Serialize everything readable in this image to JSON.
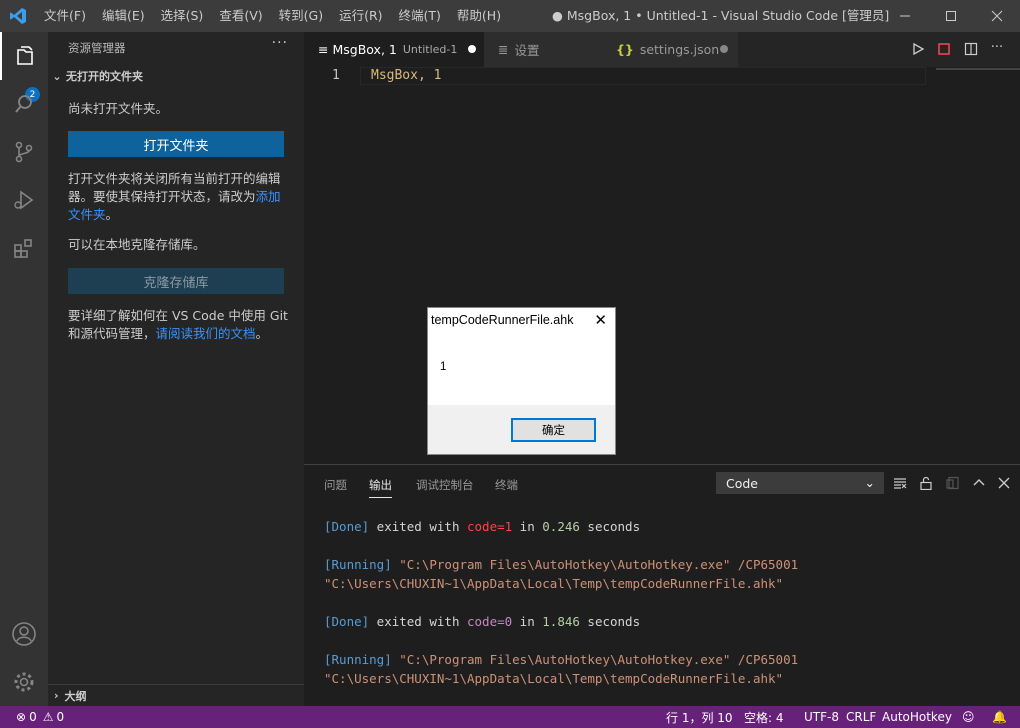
{
  "titlebar": {
    "menus": [
      "文件(F)",
      "编辑(E)",
      "选择(S)",
      "查看(V)",
      "转到(G)",
      "运行(R)",
      "终端(T)",
      "帮助(H)"
    ],
    "window_title": "● MsgBox, 1 • Untitled-1 - Visual Studio Code [管理员]"
  },
  "activitybar": {
    "badge": "2"
  },
  "sidebar": {
    "title": "资源管理器",
    "more": "···",
    "section": "无打开的文件夹",
    "no_folder": "尚未打开文件夹。",
    "open_button": "打开文件夹",
    "info_part1": "打开文件夹将关闭所有当前打开的编辑器。要使其保持打开状态，请改为",
    "info_link": "添加文件夹",
    "info_end": "。",
    "clone_info": "可以在本地克隆存储库。",
    "clone_button": "克隆存储库",
    "git_part1": "要详细了解如何在 VS Code 中使用 Git 和源代码管理，",
    "git_link": "请阅读我们的文档",
    "git_end": "。",
    "outline": "大纲"
  },
  "tabs": [
    {
      "label": "MsgBox, 1",
      "sub": "Untitled-1"
    },
    {
      "label": "设置"
    },
    {
      "label": "settings.json"
    }
  ],
  "editor": {
    "line_number": "1",
    "code": "MsgBox, 1"
  },
  "panel": {
    "tabs": [
      "问题",
      "输出",
      "调试控制台",
      "终端"
    ],
    "channel": "Code",
    "output": [
      {
        "tag": "[Done]",
        "t1": " exited with ",
        "code": "code=1",
        "t2": " in ",
        "secs": "0.246",
        "t3": " seconds"
      },
      {
        "tag": "[Running]",
        "cmd1": " \"C:\\Program Files\\AutoHotkey\\AutoHotkey.exe\" /CP65001",
        "cmd2": "\"C:\\Users\\CHUXIN~1\\AppData\\Local\\Temp\\tempCodeRunnerFile.ahk\""
      },
      {
        "tag": "[Done]",
        "t1": " exited with ",
        "code": "code=0",
        "t2": " in ",
        "secs": "1.846",
        "t3": " seconds"
      },
      {
        "tag": "[Running]",
        "cmd1": " \"C:\\Program Files\\AutoHotkey\\AutoHotkey.exe\" /CP65001",
        "cmd2": "\"C:\\Users\\CHUXIN~1\\AppData\\Local\\Temp\\tempCodeRunnerFile.ahk\""
      }
    ]
  },
  "dialog": {
    "title": "tempCodeRunnerFile.ahk",
    "close": "✕",
    "message": "1",
    "ok": "确定"
  },
  "statusbar": {
    "errors": "0",
    "warnings": "0",
    "position": "行 1，列 10",
    "spaces": "空格: 4",
    "encoding": "UTF-8",
    "eol": "CRLF",
    "language": "AutoHotkey"
  },
  "colors": {
    "statusbar": "#68217a",
    "accent": "#0e639c",
    "link": "#3794ff"
  }
}
